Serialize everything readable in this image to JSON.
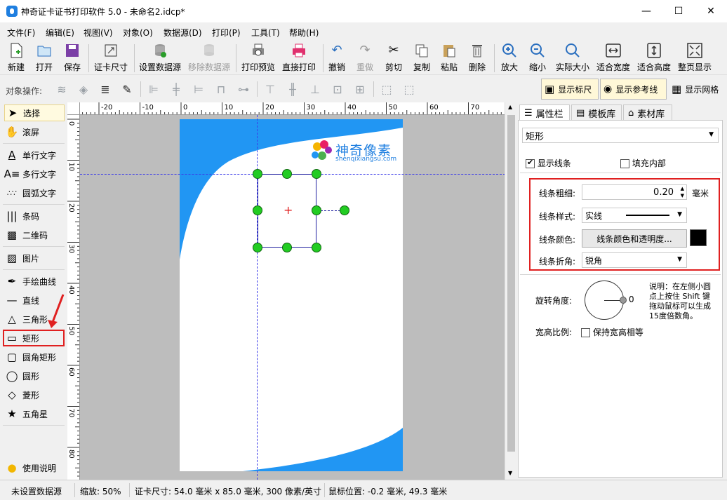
{
  "window": {
    "title": "神奇证卡证书打印软件 5.0 - 未命名2.idcp*",
    "minimize": "—",
    "maximize": "☐",
    "close": "✕"
  },
  "menu": [
    "文件(F)",
    "编辑(E)",
    "视图(V)",
    "对象(O)",
    "数据源(D)",
    "打印(P)",
    "工具(T)",
    "帮助(H)"
  ],
  "toolbar": {
    "new": "新建",
    "open": "打开",
    "save": "保存",
    "card_size": "证卡尺寸",
    "set_datasource": "设置数据源",
    "remove_datasource": "移除数据源",
    "print_preview": "打印预览",
    "direct_print": "直接打印",
    "undo": "撤销",
    "redo": "重做",
    "cut": "剪切",
    "copy": "复制",
    "paste": "粘贴",
    "delete": "删除",
    "zoom_in": "放大",
    "zoom_out": "缩小",
    "actual_size": "实际大小",
    "fit_width": "适合宽度",
    "fit_height": "适合高度",
    "fit_page": "整页显示"
  },
  "objbar": {
    "label": "对象操作:",
    "show_ruler": "显示标尺",
    "show_guides": "显示参考线",
    "show_grid": "显示网格"
  },
  "tools": {
    "select": "选择",
    "scroll": "滚屏",
    "single_text": "单行文字",
    "multi_text": "多行文字",
    "arc_text": "圆弧文字",
    "barcode": "条码",
    "qrcode": "二维码",
    "image": "图片",
    "freehand": "手绘曲线",
    "line": "直线",
    "triangle": "三角形",
    "rectangle": "矩形",
    "rounded_rect": "圆角矩形",
    "ellipse": "圆形",
    "diamond": "菱形",
    "star": "五角星",
    "help": "使用说明"
  },
  "ruler": {
    "h_labels": [
      "-20",
      "-10",
      "0",
      "10",
      "20",
      "30",
      "40",
      "50",
      "60",
      "70"
    ],
    "v_labels": [
      "0",
      "10",
      "20",
      "30",
      "40",
      "50",
      "60",
      "70",
      "80"
    ]
  },
  "card": {
    "logo_title": "神奇像素",
    "logo_url": "shenqixiangsu.com",
    "accent_color": "#2196f3",
    "handle_color": "#22cc22"
  },
  "panel": {
    "tabs": [
      "属性栏",
      "模板库",
      "素材库"
    ],
    "shape_type": "矩形",
    "show_border": "显示线条",
    "fill_inside": "填充内部",
    "line_width_label": "线条粗细:",
    "line_width_value": "0.20",
    "line_width_unit": "毫米",
    "line_style_label": "线条样式:",
    "line_style_value": "实线",
    "line_color_label": "线条颜色:",
    "line_color_button": "线条颜色和透明度...",
    "line_color_swatch": "#000000",
    "line_join_label": "线条折角:",
    "line_join_value": "锐角",
    "rotation_label": "旋转角度:",
    "rotation_value": "0",
    "rotation_note_1": "说明：在左侧小圆",
    "rotation_note_2": "点上按住 Shift 键",
    "rotation_note_3": "拖动鼠标可以生成",
    "rotation_note_4": "15度倍数角。",
    "aspect_label": "宽高比例:",
    "keep_aspect": "保持宽高相等"
  },
  "status": {
    "datasource": "未设置数据源",
    "zoom": "缩放: 50%",
    "card_size": "证卡尺寸: 54.0 毫米 x 85.0 毫米, 300 像素/英寸",
    "mouse_pos": "鼠标位置: -0.2 毫米, 49.3 毫米"
  }
}
